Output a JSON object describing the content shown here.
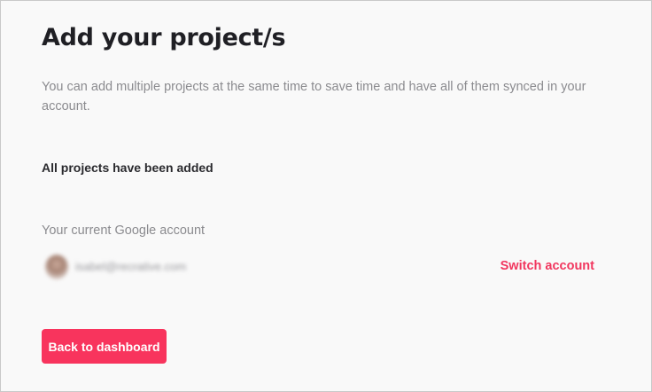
{
  "page": {
    "title": "Add your project/s",
    "description": "You can add multiple projects at the same time to save time and have all of them synced in your account.",
    "status": "All projects have been added"
  },
  "account": {
    "label": "Your current Google account",
    "email": "isabel@recrative.com",
    "switch_label": "Switch account"
  },
  "actions": {
    "back_label": "Back to dashboard"
  },
  "colors": {
    "accent": "#f8345d",
    "link": "#f1365e",
    "background": "#f9f9f9"
  }
}
